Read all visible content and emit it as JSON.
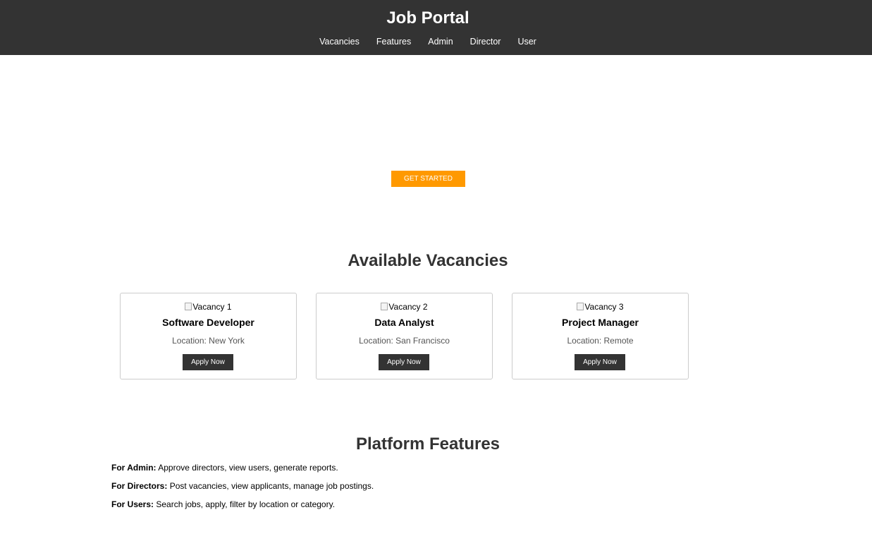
{
  "header": {
    "title": "Job Portal",
    "nav": [
      "Vacancies",
      "Features",
      "Admin",
      "Director",
      "User"
    ],
    "background": "#333333"
  },
  "hero": {
    "cta_label": "GET STARTED",
    "cta_color": "#ff9900"
  },
  "vacancies": {
    "heading": "Available Vacancies",
    "cards": [
      {
        "image_alt": "Vacancy 1",
        "title": "Software Developer",
        "location": "Location: New York",
        "button": "Apply Now"
      },
      {
        "image_alt": "Vacancy 2",
        "title": "Data Analyst",
        "location": "Location: San Francisco",
        "button": "Apply Now"
      },
      {
        "image_alt": "Vacancy 3",
        "title": "Project Manager",
        "location": "Location: Remote",
        "button": "Apply Now"
      }
    ]
  },
  "features": {
    "heading": "Platform Features",
    "items": [
      {
        "label": "For Admin:",
        "text": " Approve directors, view users, generate reports."
      },
      {
        "label": "For Directors:",
        "text": " Post vacancies, view applicants, manage job postings."
      },
      {
        "label": "For Users:",
        "text": " Search jobs, apply, filter by location or category."
      }
    ]
  }
}
